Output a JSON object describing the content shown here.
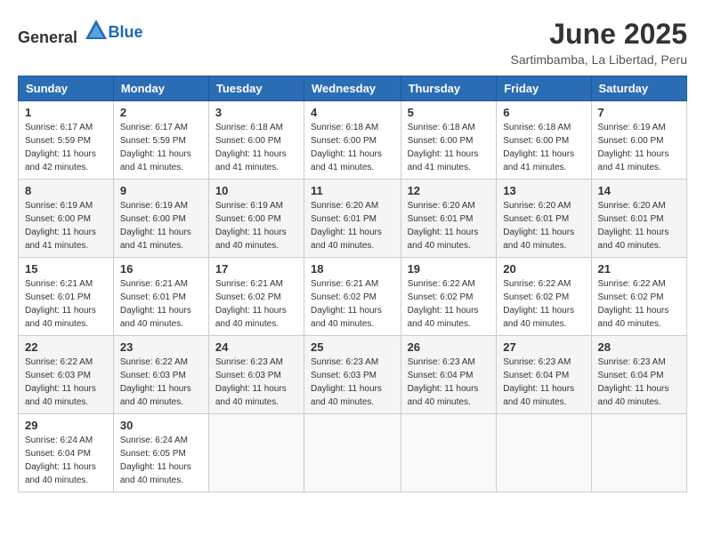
{
  "logo": {
    "general": "General",
    "blue": "Blue"
  },
  "header": {
    "month": "June 2025",
    "location": "Sartimbamba, La Libertad, Peru"
  },
  "weekdays": [
    "Sunday",
    "Monday",
    "Tuesday",
    "Wednesday",
    "Thursday",
    "Friday",
    "Saturday"
  ],
  "weeks": [
    [
      {
        "day": "1",
        "sunrise": "6:17 AM",
        "sunset": "5:59 PM",
        "daylight": "11 hours and 42 minutes."
      },
      {
        "day": "2",
        "sunrise": "6:17 AM",
        "sunset": "5:59 PM",
        "daylight": "11 hours and 41 minutes."
      },
      {
        "day": "3",
        "sunrise": "6:18 AM",
        "sunset": "6:00 PM",
        "daylight": "11 hours and 41 minutes."
      },
      {
        "day": "4",
        "sunrise": "6:18 AM",
        "sunset": "6:00 PM",
        "daylight": "11 hours and 41 minutes."
      },
      {
        "day": "5",
        "sunrise": "6:18 AM",
        "sunset": "6:00 PM",
        "daylight": "11 hours and 41 minutes."
      },
      {
        "day": "6",
        "sunrise": "6:18 AM",
        "sunset": "6:00 PM",
        "daylight": "11 hours and 41 minutes."
      },
      {
        "day": "7",
        "sunrise": "6:19 AM",
        "sunset": "6:00 PM",
        "daylight": "11 hours and 41 minutes."
      }
    ],
    [
      {
        "day": "8",
        "sunrise": "6:19 AM",
        "sunset": "6:00 PM",
        "daylight": "11 hours and 41 minutes."
      },
      {
        "day": "9",
        "sunrise": "6:19 AM",
        "sunset": "6:00 PM",
        "daylight": "11 hours and 41 minutes."
      },
      {
        "day": "10",
        "sunrise": "6:19 AM",
        "sunset": "6:00 PM",
        "daylight": "11 hours and 40 minutes."
      },
      {
        "day": "11",
        "sunrise": "6:20 AM",
        "sunset": "6:01 PM",
        "daylight": "11 hours and 40 minutes."
      },
      {
        "day": "12",
        "sunrise": "6:20 AM",
        "sunset": "6:01 PM",
        "daylight": "11 hours and 40 minutes."
      },
      {
        "day": "13",
        "sunrise": "6:20 AM",
        "sunset": "6:01 PM",
        "daylight": "11 hours and 40 minutes."
      },
      {
        "day": "14",
        "sunrise": "6:20 AM",
        "sunset": "6:01 PM",
        "daylight": "11 hours and 40 minutes."
      }
    ],
    [
      {
        "day": "15",
        "sunrise": "6:21 AM",
        "sunset": "6:01 PM",
        "daylight": "11 hours and 40 minutes."
      },
      {
        "day": "16",
        "sunrise": "6:21 AM",
        "sunset": "6:01 PM",
        "daylight": "11 hours and 40 minutes."
      },
      {
        "day": "17",
        "sunrise": "6:21 AM",
        "sunset": "6:02 PM",
        "daylight": "11 hours and 40 minutes."
      },
      {
        "day": "18",
        "sunrise": "6:21 AM",
        "sunset": "6:02 PM",
        "daylight": "11 hours and 40 minutes."
      },
      {
        "day": "19",
        "sunrise": "6:22 AM",
        "sunset": "6:02 PM",
        "daylight": "11 hours and 40 minutes."
      },
      {
        "day": "20",
        "sunrise": "6:22 AM",
        "sunset": "6:02 PM",
        "daylight": "11 hours and 40 minutes."
      },
      {
        "day": "21",
        "sunrise": "6:22 AM",
        "sunset": "6:02 PM",
        "daylight": "11 hours and 40 minutes."
      }
    ],
    [
      {
        "day": "22",
        "sunrise": "6:22 AM",
        "sunset": "6:03 PM",
        "daylight": "11 hours and 40 minutes."
      },
      {
        "day": "23",
        "sunrise": "6:22 AM",
        "sunset": "6:03 PM",
        "daylight": "11 hours and 40 minutes."
      },
      {
        "day": "24",
        "sunrise": "6:23 AM",
        "sunset": "6:03 PM",
        "daylight": "11 hours and 40 minutes."
      },
      {
        "day": "25",
        "sunrise": "6:23 AM",
        "sunset": "6:03 PM",
        "daylight": "11 hours and 40 minutes."
      },
      {
        "day": "26",
        "sunrise": "6:23 AM",
        "sunset": "6:04 PM",
        "daylight": "11 hours and 40 minutes."
      },
      {
        "day": "27",
        "sunrise": "6:23 AM",
        "sunset": "6:04 PM",
        "daylight": "11 hours and 40 minutes."
      },
      {
        "day": "28",
        "sunrise": "6:23 AM",
        "sunset": "6:04 PM",
        "daylight": "11 hours and 40 minutes."
      }
    ],
    [
      {
        "day": "29",
        "sunrise": "6:24 AM",
        "sunset": "6:04 PM",
        "daylight": "11 hours and 40 minutes."
      },
      {
        "day": "30",
        "sunrise": "6:24 AM",
        "sunset": "6:05 PM",
        "daylight": "11 hours and 40 minutes."
      },
      null,
      null,
      null,
      null,
      null
    ]
  ],
  "labels": {
    "sunrise": "Sunrise:",
    "sunset": "Sunset:",
    "daylight": "Daylight: 11 hours"
  }
}
